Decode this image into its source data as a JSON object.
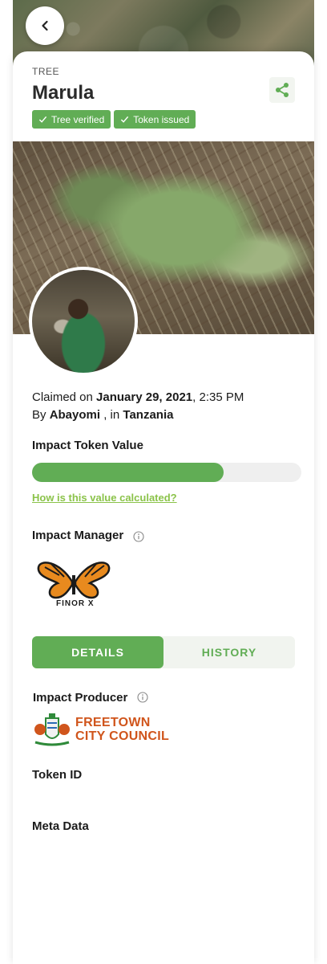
{
  "nav": {
    "back_label": "Back"
  },
  "header": {
    "type_label": "TREE",
    "title": "Marula",
    "badges": [
      {
        "label": "Tree verified"
      },
      {
        "label": "Token issued"
      }
    ]
  },
  "claim": {
    "claimed_prefix": "Claimed on ",
    "date": "January 29, 2021",
    "time": ", 2:35 PM",
    "by_prefix": "By ",
    "planter": "Abayomi",
    "in_prefix": " , in ",
    "country": "Tanzania"
  },
  "impact_token": {
    "heading": "Impact Token Value",
    "progress_fraction": 0.71,
    "calc_link": "How is this value calculated?"
  },
  "impact_manager": {
    "heading": "Impact Manager",
    "logo_text": "FINOR X"
  },
  "tabs": [
    {
      "label": "DETAILS",
      "active": true
    },
    {
      "label": "HISTORY",
      "active": false
    }
  ],
  "details": {
    "impact_producer_heading": "Impact Producer",
    "producer_line1": "FREETOWN",
    "producer_line2": "CITY COUNCIL",
    "token_id_heading": "Token ID",
    "meta_data_heading": "Meta Data"
  },
  "colors": {
    "accent": "#61ad55",
    "link": "#8bc34a",
    "producer": "#d0551c"
  },
  "icons": {
    "back": "chevron-left-icon",
    "share": "share-icon",
    "check": "check-icon",
    "info": "info-icon"
  }
}
